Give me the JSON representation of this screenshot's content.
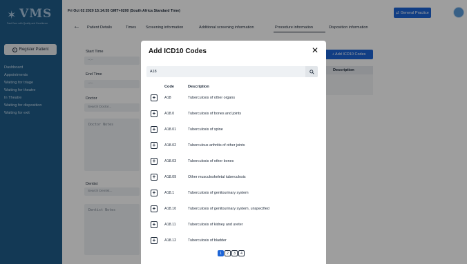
{
  "sidebar": {
    "logo_text": "VMS",
    "logo_tagline": "Fast Care with Quality and Excellence",
    "register_label": "Register Patient",
    "items": [
      {
        "label": "Dashboard"
      },
      {
        "label": "Appointments"
      },
      {
        "label": "Waiting for triage"
      },
      {
        "label": "Waiting for theatre"
      },
      {
        "label": "In Theatre"
      },
      {
        "label": "Waiting for disposition"
      },
      {
        "label": "Waiting for exit"
      }
    ]
  },
  "header": {
    "datetime": "Fri Oct 02 2020 15:14:55 GMT+0200 (South Africa Standard Time)",
    "practice_button": "General Practice"
  },
  "tabs": [
    {
      "label": "Patient Details"
    },
    {
      "label": "Times"
    },
    {
      "label": "Screening information"
    },
    {
      "label": "Additional screening information"
    },
    {
      "label": "Procedure information"
    },
    {
      "label": "Disposition information"
    }
  ],
  "active_tab": "Procedure information",
  "form": {
    "start_time_label": "Start Time",
    "start_time_value": "--:--",
    "end_time_label": "End Time",
    "end_time_value": "--:--",
    "doctor_label": "Doctor",
    "doctor_placeholder": "Search Doctor...",
    "doctor_notes_placeholder": "Doctor Notes",
    "dentist_label": "Dentist",
    "dentist_placeholder": "Search Dentist...",
    "dentist_notes_placeholder": "Dentist Notes",
    "add_codes_button": "+ Add ICD10 Codes",
    "description_header": "Description"
  },
  "modal": {
    "title": "Add ICD10 Codes",
    "close_glyph": "✕",
    "search_value": "A18",
    "code_header": "Code",
    "description_header": "Description",
    "rows": [
      {
        "code": "A18",
        "description": "Tuberculosis of other organs"
      },
      {
        "code": "A18.0",
        "description": "Tuberculosis of bones and joints"
      },
      {
        "code": "A18.01",
        "description": "Tuberculosis of spine"
      },
      {
        "code": "A18.02",
        "description": "Tuberculous arthritis of other joints"
      },
      {
        "code": "A18.03",
        "description": "Tuberculosis of other bones"
      },
      {
        "code": "A18.09",
        "description": "Other musculoskeletal tuberculosis"
      },
      {
        "code": "A18.1",
        "description": "Tuberculosis of genitourinary system"
      },
      {
        "code": "A18.10",
        "description": "Tuberculosis of genitourinary system, unspecified"
      },
      {
        "code": "A18.11",
        "description": "Tuberculosis of kidney and ureter"
      },
      {
        "code": "A18.12",
        "description": "Tuberculosis of bladder"
      }
    ],
    "pages": [
      "1",
      "2",
      "3",
      "4"
    ],
    "current_page": "1"
  },
  "colors": {
    "sidebar": "#1f5d8a",
    "accent": "#1c64d6"
  }
}
